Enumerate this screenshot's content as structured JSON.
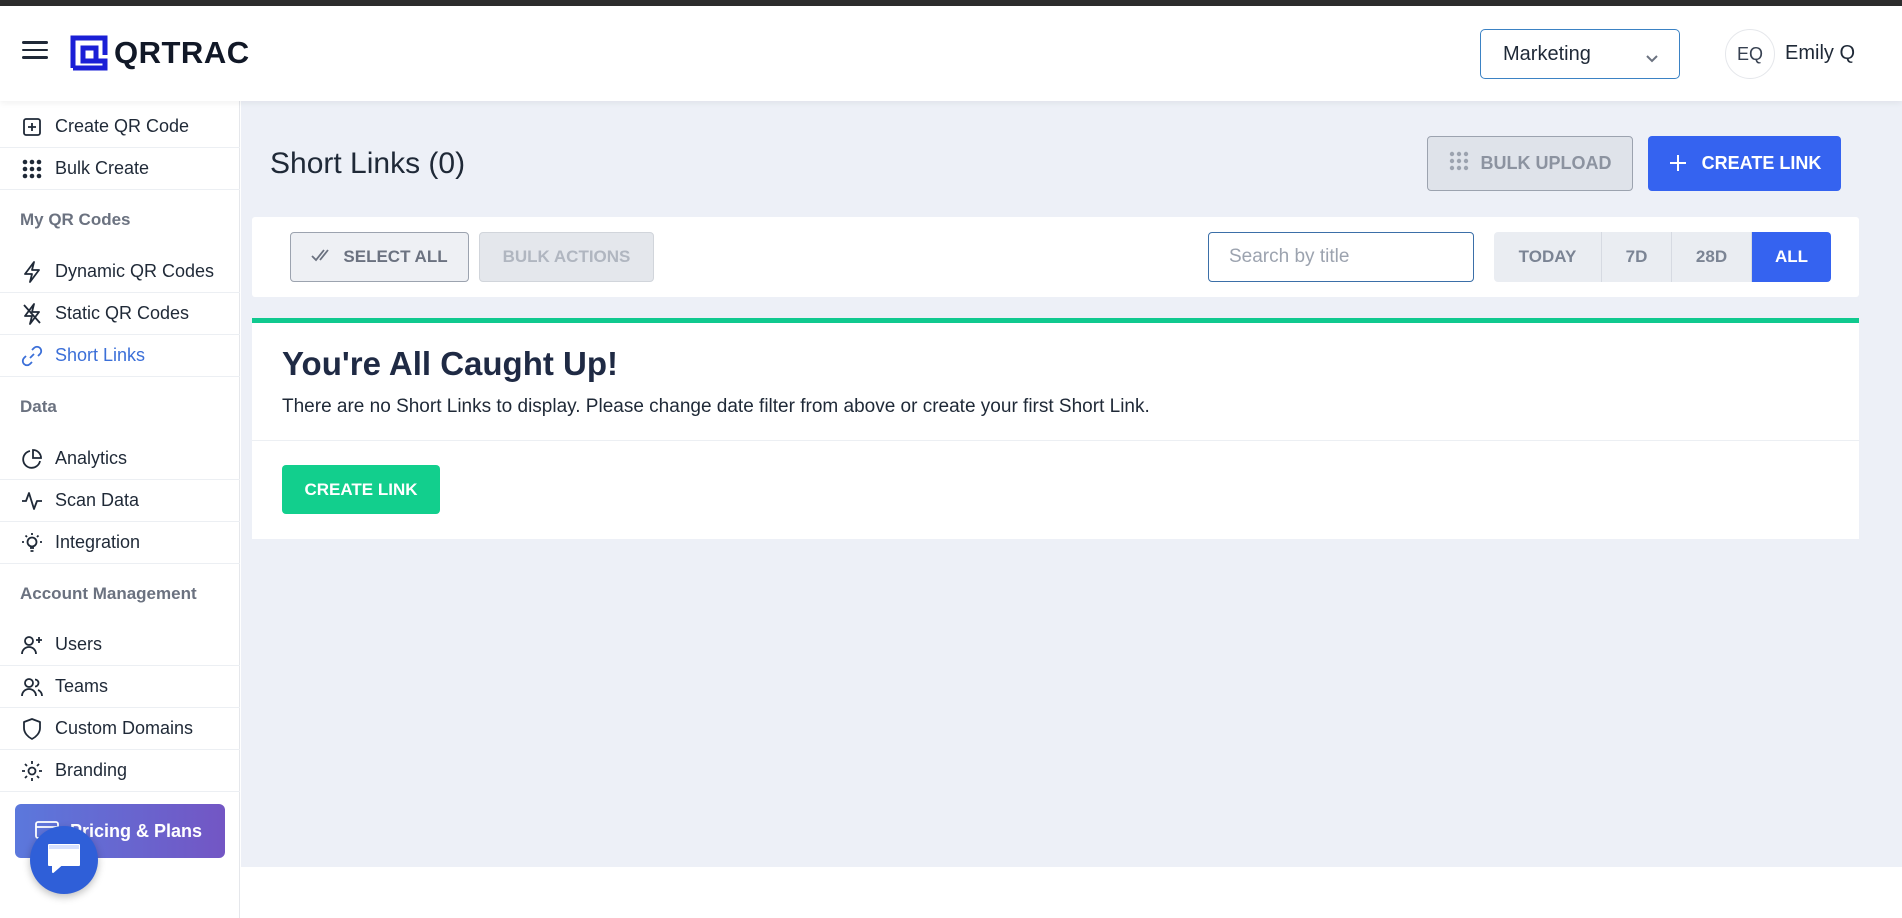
{
  "app": {
    "name": "QRTRAC"
  },
  "header": {
    "workspace": "Marketing",
    "user_initials": "EQ",
    "user_name": "Emily Q"
  },
  "sidebar": {
    "top_items": [
      {
        "label": "Create QR Code",
        "icon": "plus-square-icon"
      },
      {
        "label": "Bulk Create",
        "icon": "grid-dots-icon"
      }
    ],
    "sections": [
      {
        "title": "My QR Codes",
        "items": [
          {
            "label": "Dynamic QR Codes",
            "icon": "lightning-icon"
          },
          {
            "label": "Static QR Codes",
            "icon": "lightning-off-icon"
          },
          {
            "label": "Short Links",
            "icon": "link-icon",
            "active": true
          }
        ]
      },
      {
        "title": "Data",
        "items": [
          {
            "label": "Analytics",
            "icon": "pie-chart-icon"
          },
          {
            "label": "Scan Data",
            "icon": "activity-icon"
          },
          {
            "label": "Integration",
            "icon": "bulb-icon"
          }
        ]
      },
      {
        "title": "Account Management",
        "items": [
          {
            "label": "Users",
            "icon": "user-plus-icon"
          },
          {
            "label": "Teams",
            "icon": "users-icon"
          },
          {
            "label": "Custom Domains",
            "icon": "shield-icon"
          },
          {
            "label": "Branding",
            "icon": "sun-icon"
          }
        ]
      }
    ],
    "pricing_label": "Pricing & Plans"
  },
  "page": {
    "title": "Short Links (0)",
    "bulk_upload_label": "BULK UPLOAD",
    "create_link_label": "CREATE LINK"
  },
  "filters": {
    "select_all_label": "SELECT ALL",
    "bulk_actions_label": "BULK ACTIONS",
    "search_placeholder": "Search by title",
    "search_value": "",
    "ranges": [
      "TODAY",
      "7D",
      "28D",
      "ALL"
    ],
    "active_range": "ALL"
  },
  "empty_state": {
    "title": "You're All Caught Up!",
    "message": "There are no Short Links to display. Please change date filter from above or create your first Short Link.",
    "button_label": "CREATE LINK"
  },
  "colors": {
    "brand": "#1a1fd6",
    "primary": "#3563f0",
    "success": "#12cf8d",
    "active_nav": "#3b6fd8"
  }
}
